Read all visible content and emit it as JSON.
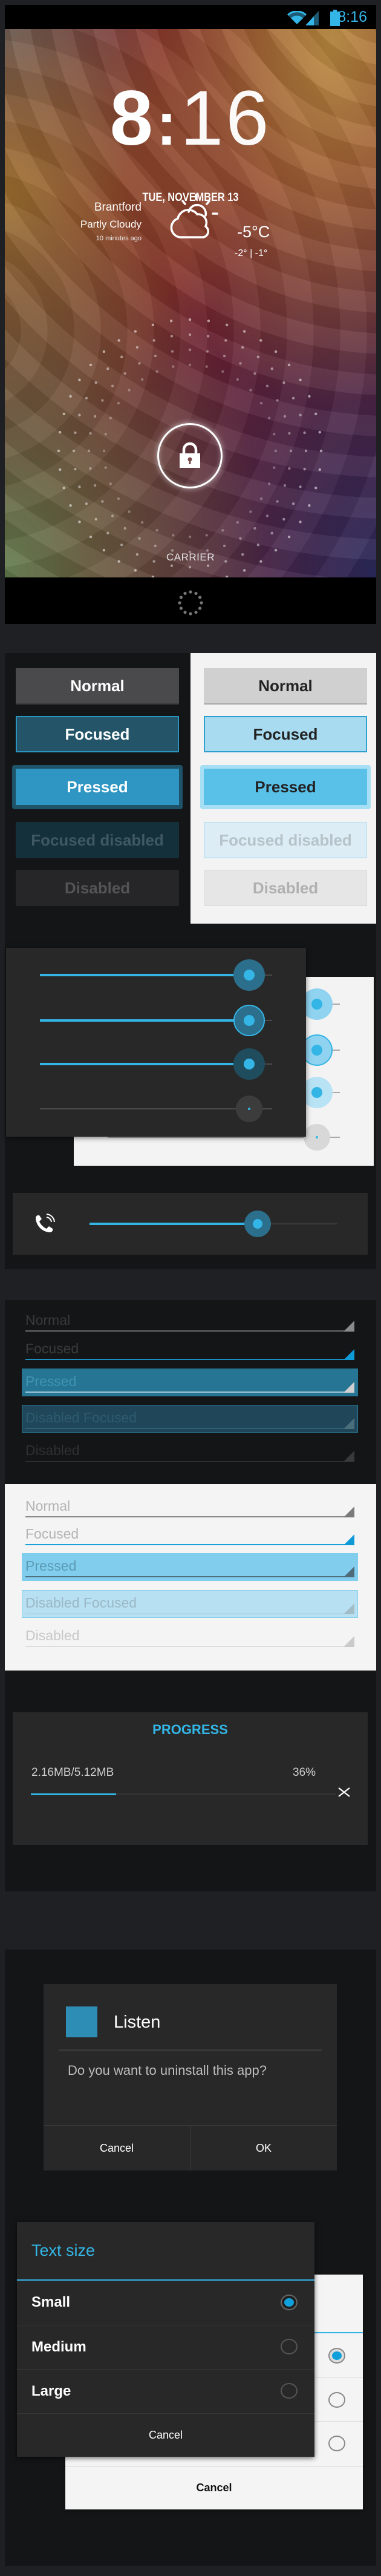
{
  "colors": {
    "accent": "#33b5e5",
    "page_background": "#1f2023",
    "panel": "#141517"
  },
  "lockscreen": {
    "status_bar": {
      "time": "8:16",
      "icons": [
        "wifi-icon",
        "signal-icon",
        "battery-icon"
      ]
    },
    "clock": {
      "hours": "8",
      "separator": ":",
      "minutes": "16"
    },
    "date": "TUE, NOVEMBER 13",
    "weather": {
      "city": "Brantford",
      "condition": "Partly Cloudy",
      "updated": "10 minutes ago",
      "temperature": "-5°C",
      "range": "-2° | -1°",
      "icon": "partly-cloudy-icon"
    },
    "unlock_icon": "lock-icon",
    "carrier": "CARRIER"
  },
  "buttons": {
    "dark": [
      "Normal",
      "Focused",
      "Pressed",
      "Focused disabled",
      "Disabled"
    ],
    "light": [
      "Normal",
      "Focused",
      "Pressed",
      "Focused disabled",
      "Disabled"
    ]
  },
  "sliders": {
    "states": [
      "normal",
      "focused",
      "pressed",
      "disabled"
    ],
    "value": 0.9,
    "volume": {
      "icon": "phone-ring-icon",
      "value": 0.68
    }
  },
  "spinners": {
    "dark": [
      "Normal",
      "Focused",
      "Pressed",
      "Disabled Focused",
      "Disabled"
    ],
    "light": [
      "Normal",
      "Focused",
      "Pressed",
      "Disabled Focused",
      "Disabled"
    ]
  },
  "progress": {
    "title": "PROGRESS",
    "size": "2.16MB/5.12MB",
    "percent": "36%",
    "bar_fill": 0.28,
    "close_icon": "close-icon"
  },
  "alert_dialog": {
    "title": "Listen",
    "message": "Do you want to uninstall this app?",
    "cancel": "Cancel",
    "ok": "OK"
  },
  "list_dialog": {
    "title": "Text size",
    "options": [
      "Small",
      "Medium",
      "Large"
    ],
    "selected": 0,
    "cancel": "Cancel"
  },
  "list_dialog_light": {
    "cancel": "Cancel",
    "selected": 0
  }
}
